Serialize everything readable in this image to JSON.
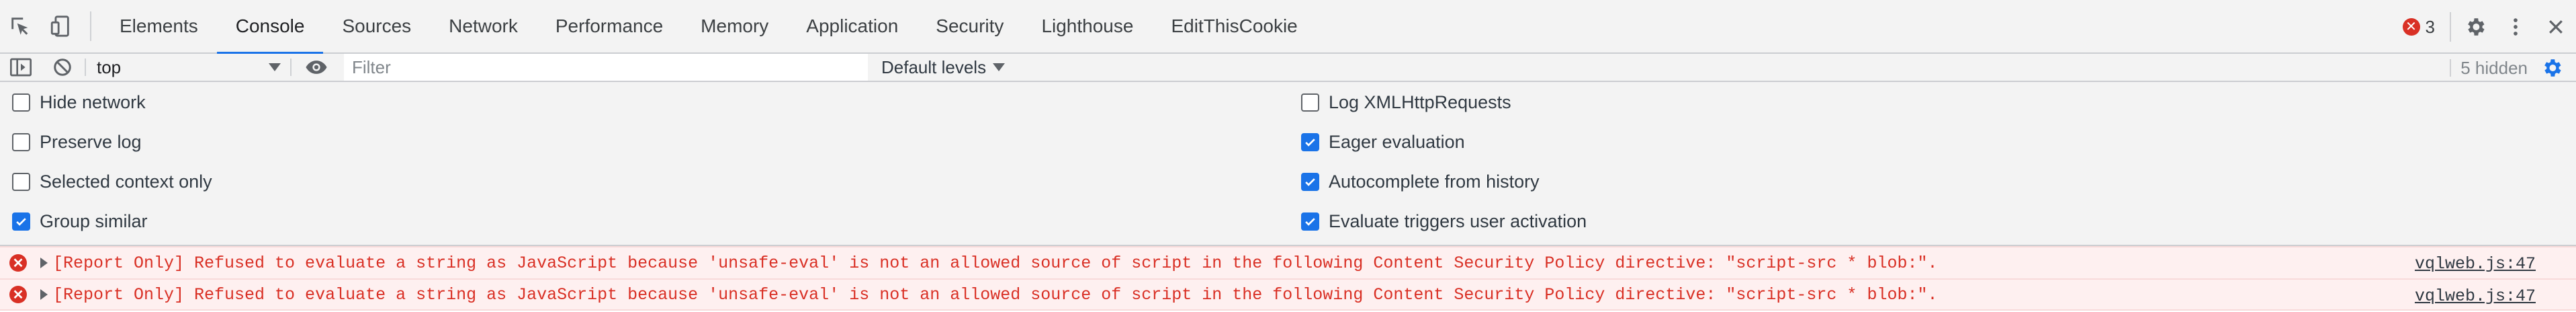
{
  "tabbar": {
    "tabs": [
      {
        "label": "Elements"
      },
      {
        "label": "Console",
        "active": true
      },
      {
        "label": "Sources"
      },
      {
        "label": "Network"
      },
      {
        "label": "Performance"
      },
      {
        "label": "Memory"
      },
      {
        "label": "Application"
      },
      {
        "label": "Security"
      },
      {
        "label": "Lighthouse"
      },
      {
        "label": "EditThisCookie"
      }
    ],
    "error_count": "3",
    "icons": [
      "inspect-element-icon",
      "device-toolbar-icon",
      "settings-gear-icon",
      "more-vertical-icon",
      "close-icon"
    ]
  },
  "toolbar": {
    "context": "top",
    "filter_placeholder": "Filter",
    "filter_value": "",
    "levels": "Default levels",
    "hidden": "5 hidden"
  },
  "settings": {
    "left": [
      {
        "label": "Hide network",
        "checked": false
      },
      {
        "label": "Preserve log",
        "checked": false
      },
      {
        "label": "Selected context only",
        "checked": false
      },
      {
        "label": "Group similar",
        "checked": true
      }
    ],
    "right": [
      {
        "label": "Log XMLHttpRequests",
        "checked": false
      },
      {
        "label": "Eager evaluation",
        "checked": true
      },
      {
        "label": "Autocomplete from history",
        "checked": true
      },
      {
        "label": "Evaluate triggers user activation",
        "checked": true
      }
    ]
  },
  "messages": [
    {
      "text": "[Report Only] Refused to evaluate a string as JavaScript because 'unsafe-eval' is not an allowed source of script in the following Content Security Policy directive: \"script-src * blob:\".",
      "source": "vqlweb.js:47"
    },
    {
      "text": "[Report Only] Refused to evaluate a string as JavaScript because 'unsafe-eval' is not an allowed source of script in the following Content Security Policy directive: \"script-src * blob:\".",
      "source": "vqlweb.js:47"
    }
  ],
  "colors": {
    "accent": "#1a73e8",
    "error": "#d93025",
    "error_bg": "#fef0f0",
    "panel_bg": "#f3f3f3"
  }
}
